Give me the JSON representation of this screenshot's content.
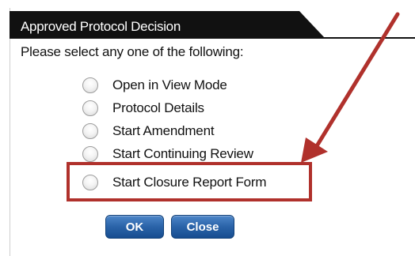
{
  "dialog": {
    "title": "Approved Protocol Decision",
    "instruction": "Please select any one of the following:",
    "options": [
      {
        "label": "Open in View Mode"
      },
      {
        "label": "Protocol Details"
      },
      {
        "label": "Start Amendment"
      },
      {
        "label": "Start Continuing Review"
      },
      {
        "label": "Start Closure Report Form"
      }
    ],
    "buttons": {
      "ok_label": "OK",
      "close_label": "Close"
    }
  },
  "colors": {
    "title_bar": "#111111",
    "highlight": "#b0312c",
    "button": "#2a63a8"
  }
}
